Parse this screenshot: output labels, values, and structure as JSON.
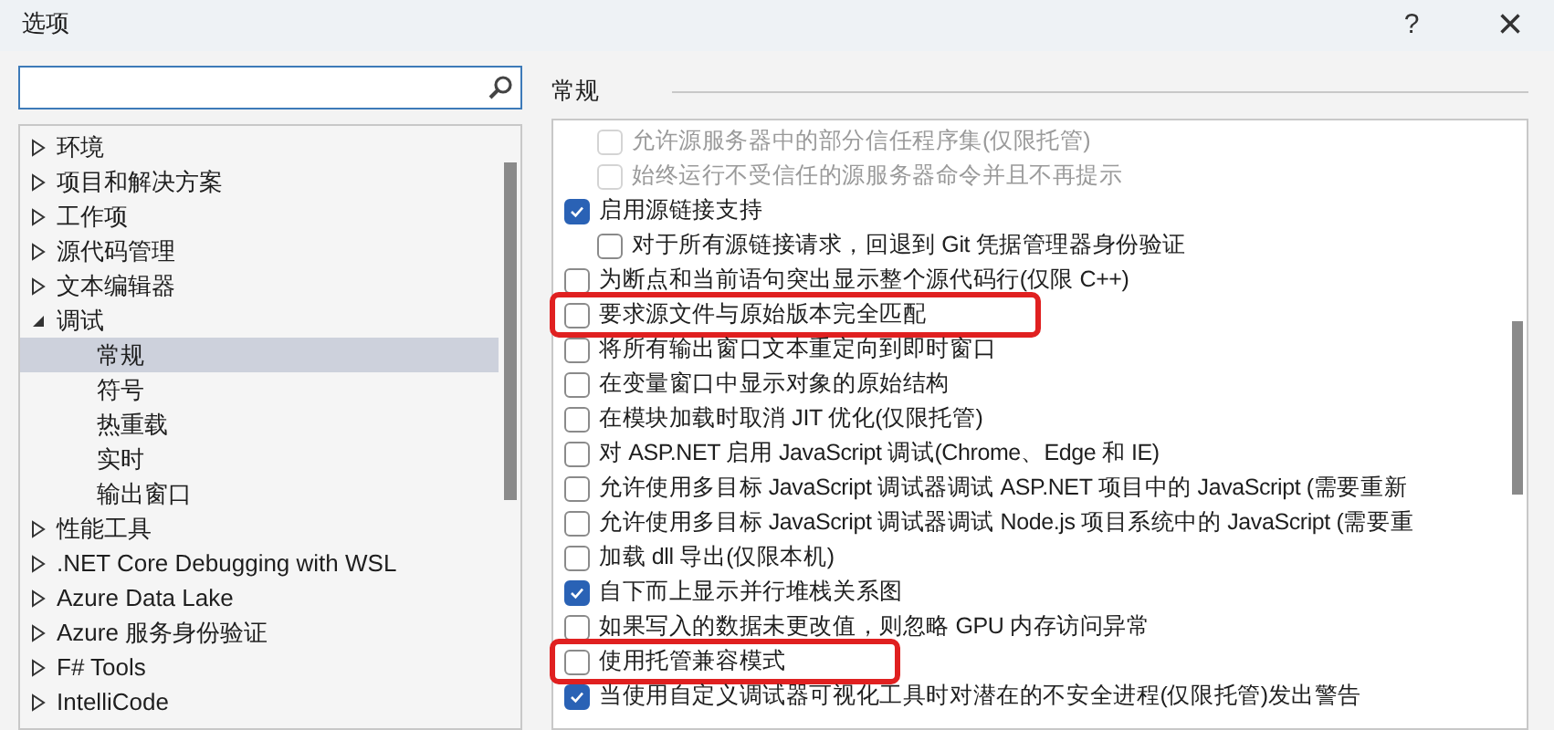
{
  "window": {
    "title": "选项",
    "help": "?",
    "close": "×"
  },
  "tree": [
    {
      "label": "环境",
      "expanded": false,
      "selected": false
    },
    {
      "label": "项目和解决方案",
      "expanded": false,
      "selected": false
    },
    {
      "label": "工作项",
      "expanded": false,
      "selected": false
    },
    {
      "label": "源代码管理",
      "expanded": false,
      "selected": false
    },
    {
      "label": "文本编辑器",
      "expanded": false,
      "selected": false
    },
    {
      "label": "调试",
      "expanded": true,
      "selected": false,
      "children": [
        {
          "label": "常规",
          "selected": true
        },
        {
          "label": "符号",
          "selected": false
        },
        {
          "label": "热重载",
          "selected": false
        },
        {
          "label": "实时",
          "selected": false
        },
        {
          "label": "输出窗口",
          "selected": false
        }
      ]
    },
    {
      "label": "性能工具",
      "expanded": false,
      "selected": false
    },
    {
      "label": ".NET Core Debugging with WSL",
      "expanded": false,
      "selected": false
    },
    {
      "label": "Azure Data Lake",
      "expanded": false,
      "selected": false
    },
    {
      "label": "Azure 服务身份验证",
      "expanded": false,
      "selected": false
    },
    {
      "label": "F# Tools",
      "expanded": false,
      "selected": false
    },
    {
      "label": "IntelliCode",
      "expanded": false,
      "selected": false
    }
  ],
  "section_title": "常规",
  "options": [
    {
      "children": [
        {
          "label": "允许源服务器中的部分信任程序集(仅限托管)",
          "checked": false,
          "disabled": true,
          "highlighted": false
        },
        {
          "label": "始终运行不受信任的源服务器命令并且不再提示",
          "checked": false,
          "disabled": true,
          "highlighted": false
        }
      ]
    },
    {
      "label": "启用源链接支持",
      "checked": true,
      "disabled": false,
      "highlighted": false,
      "children": [
        {
          "label": "对于所有源链接请求，回退到 Git 凭据管理器身份验证",
          "checked": false,
          "disabled": false,
          "highlighted": false
        }
      ]
    },
    {
      "label": "为断点和当前语句突出显示整个源代码行(仅限 C++)",
      "checked": false,
      "disabled": false,
      "highlighted": false
    },
    {
      "label": "要求源文件与原始版本完全匹配",
      "checked": false,
      "disabled": false,
      "highlighted": true
    },
    {
      "label": "将所有输出窗口文本重定向到即时窗口",
      "checked": false,
      "disabled": false,
      "highlighted": false
    },
    {
      "label": "在变量窗口中显示对象的原始结构",
      "checked": false,
      "disabled": false,
      "highlighted": false
    },
    {
      "label": "在模块加载时取消 JIT 优化(仅限托管)",
      "checked": false,
      "disabled": false,
      "highlighted": false
    },
    {
      "label": "对 ASP.NET 启用 JavaScript 调试(Chrome、Edge 和 IE)",
      "checked": false,
      "disabled": false,
      "highlighted": false
    },
    {
      "label": "允许使用多目标 JavaScript 调试器调试 ASP.NET 项目中的 JavaScript (需要重新",
      "checked": false,
      "disabled": false,
      "highlighted": false
    },
    {
      "label": "允许使用多目标 JavaScript 调试器调试 Node.js 项目系统中的 JavaScript (需要重",
      "checked": false,
      "disabled": false,
      "highlighted": false
    },
    {
      "label": "加载 dll 导出(仅限本机)",
      "checked": false,
      "disabled": false,
      "highlighted": false
    },
    {
      "label": "自下而上显示并行堆栈关系图",
      "checked": true,
      "disabled": false,
      "highlighted": false
    },
    {
      "label": "如果写入的数据未更改值，则忽略 GPU 内存访问异常",
      "checked": false,
      "disabled": false,
      "highlighted": false
    },
    {
      "label": "使用托管兼容模式",
      "checked": false,
      "disabled": false,
      "highlighted": true
    },
    {
      "label": "当使用自定义调试器可视化工具时对潜在的不安全进程(仅限托管)发出警告",
      "checked": true,
      "disabled": false,
      "highlighted": false
    }
  ]
}
